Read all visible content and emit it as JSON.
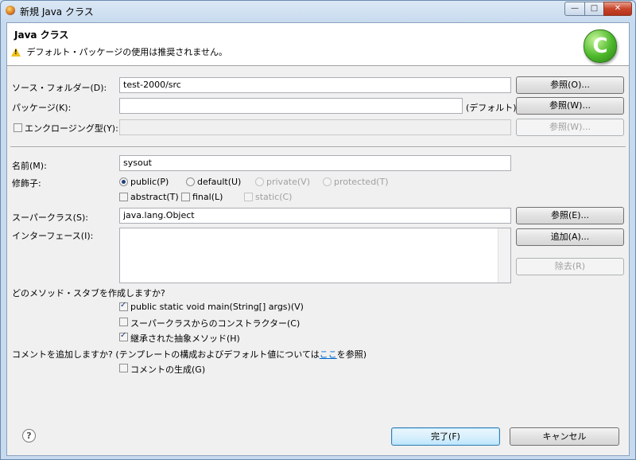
{
  "window": {
    "title": "新規 Java クラス",
    "controls": {
      "minimize": "—",
      "maximize": "□",
      "close": "✕"
    }
  },
  "header": {
    "title": "Java クラス",
    "warning": "デフォルト・パッケージの使用は推奨されません。",
    "logo_letter": "C"
  },
  "source_folder": {
    "label": "ソース・フォルダー(D):",
    "value": "test-2000/src",
    "browse": "参照(O)..."
  },
  "package": {
    "label": "パッケージ(K):",
    "value": "",
    "suffix": "(デフォルト)",
    "browse": "参照(W)..."
  },
  "enclosing": {
    "label": "エンクロージング型(Y):",
    "checked": false,
    "value": "",
    "browse": "参照(W)..."
  },
  "name": {
    "label": "名前(M):",
    "value": "sysout"
  },
  "modifiers": {
    "label": "修飾子:",
    "access": [
      {
        "label": "public(P)",
        "selected": true,
        "enabled": true
      },
      {
        "label": "default(U)",
        "selected": false,
        "enabled": true
      },
      {
        "label": "private(V)",
        "selected": false,
        "enabled": false
      },
      {
        "label": "protected(T)",
        "selected": false,
        "enabled": false
      }
    ],
    "flags": [
      {
        "label": "abstract(T)",
        "checked": false,
        "enabled": true
      },
      {
        "label": "final(L)",
        "checked": false,
        "enabled": true
      },
      {
        "label": "static(C)",
        "checked": false,
        "enabled": false
      }
    ]
  },
  "superclass": {
    "label": "スーパークラス(S):",
    "value": "java.lang.Object",
    "browse": "参照(E)..."
  },
  "interfaces": {
    "label": "インターフェース(I):",
    "add": "追加(A)...",
    "remove": "除去(R)"
  },
  "stubs": {
    "question": "どのメソッド・スタブを作成しますか?",
    "items": [
      {
        "label": "public static void main(String[] args)(V)",
        "checked": true
      },
      {
        "label": "スーパークラスからのコンストラクター(C)",
        "checked": false
      },
      {
        "label": "継承された抽象メソッド(H)",
        "checked": true
      }
    ]
  },
  "comments": {
    "question_pre": "コメントを追加しますか? (テンプレートの構成およびデフォルト値については",
    "link": "ここ",
    "question_post": "を参照)",
    "generate": {
      "label": "コメントの生成(G)",
      "checked": false
    }
  },
  "footer": {
    "help": "?",
    "finish": "完了(F)",
    "cancel": "キャンセル"
  }
}
